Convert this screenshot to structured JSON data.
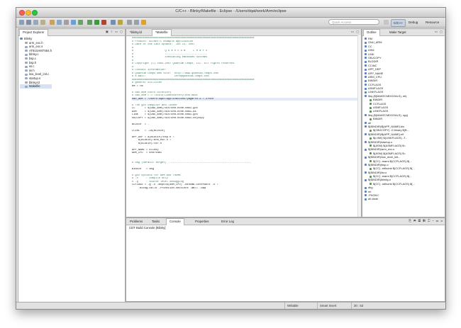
{
  "window": {
    "title": "C/C++ - Blinky/Makefile - Eclipse - /Users/dqat/work/Arm/eclipse"
  },
  "toolbar": {
    "quick_access_placeholder": "Quick Access",
    "perspectives": [
      "C/C++",
      "Debug",
      "Resource"
    ]
  },
  "project_explorer": {
    "tab_label": "Project Explorer",
    "items": [
      {
        "label": "Blinky",
        "depth": 0,
        "icon": "project-icon"
      },
      {
        "label": "arm_exc.h",
        "depth": 1,
        "icon": "file-icon"
      },
      {
        "label": "arm_exc.s",
        "depth": 1,
        "icon": "file-icon"
      },
      {
        "label": "AT91SAM7S64.h",
        "depth": 1,
        "icon": "file-icon"
      },
      {
        "label": "blinky.c",
        "depth": 1,
        "icon": "file-icon"
      },
      {
        "label": "bsp.c",
        "depth": 1,
        "icon": "file-icon"
      },
      {
        "label": "bsp.h",
        "depth": 1,
        "icon": "file-icon"
      },
      {
        "label": "isr.c",
        "depth": 1,
        "icon": "file-icon"
      },
      {
        "label": "isr.h",
        "depth": 1,
        "icon": "file-icon"
      },
      {
        "label": "low_level_init.c",
        "depth": 1,
        "icon": "file-icon"
      },
      {
        "label": "startup.s",
        "depth": 1,
        "icon": "file-icon"
      },
      {
        "label": "blinky.ld",
        "depth": 1,
        "icon": "file-icon"
      },
      {
        "label": "Makefile",
        "depth": 1,
        "icon": "file-icon"
      }
    ]
  },
  "editor": {
    "tabs": [
      "*blinky.ld",
      "*Makefile"
    ],
    "lines": [
      {
        "t": "##############################################################################",
        "c": "comment"
      },
      {
        "t": "# Product: BLINKY/C example application",
        "c": "comment"
      },
      {
        "t": "# Date of the Last Update:  Jun 14, 2007",
        "c": "comment"
      },
      {
        "t": "#",
        "c": "comment"
      },
      {
        "t": "#                    Q u a n t u m     L e a P s",
        "c": "comment"
      },
      {
        "t": "#                    ---------------------------",
        "c": "comment"
      },
      {
        "t": "#                    innovating embedded systems",
        "c": "comment"
      },
      {
        "t": "#",
        "c": "comment"
      },
      {
        "t": "# Copyright (C) 2002-2007 Quantum Leaps, LLC. All rights reserved.",
        "c": "comment"
      },
      {
        "t": "#",
        "c": "comment"
      },
      {
        "t": "# Contact information:",
        "c": "comment"
      },
      {
        "t": "# Quantum Leaps Web site:  http://www.quantum-leaps.com",
        "c": "comment"
      },
      {
        "t": "# e-mail:                  info@quantum-leaps.com",
        "c": "comment"
      },
      {
        "t": "##############################################################################",
        "c": "comment"
      },
      {
        "t": "# general utilities",
        "c": "comment"
      },
      {
        "t": "RM = rm",
        "c": "plain"
      },
      {
        "t": "",
        "c": "plain"
      },
      {
        "t": "# GNU-ARM tools directory",
        "c": "comment"
      },
      {
        "t": "# GNU_ARM = C:\\tools\\CodeSourcery\\arm-eabi",
        "c": "comment"
      },
      {
        "t": "GNU_ARM = /Users/dqat/Applications/yagarto-4.7.2/bin",
        "c": "plain",
        "hl": true
      },
      {
        "t": "",
        "c": "plain"
      },
      {
        "t": "# The gcc compiler and linker",
        "c": "comment"
      },
      {
        "t": "CC      = $(GNU_ARM)/bin/arm-none-eabi-gcc",
        "c": "plain"
      },
      {
        "t": "ASM     = $(GNU_ARM)/bin/arm-none-eabi-as",
        "c": "plain"
      },
      {
        "t": "LINK    = $(GNU_ARM)/bin/arm-none-eabi-gcc",
        "c": "plain"
      },
      {
        "t": "OBJCOPY = $(GNU_ARM)/bin/arm-none-eabi-objcopy",
        "c": "plain"
      },
      {
        "t": "",
        "c": "plain"
      },
      {
        "t": "BLDDIR  = .",
        "c": "plain"
      },
      {
        "t": "",
        "c": "plain"
      },
      {
        "t": "CCINC   = -I$(BLDDIR)",
        "c": "plain"
      },
      {
        "t": "",
        "c": "plain"
      },
      {
        "t": "APP_DEP = $(BLDDIR)/bsp.h \\",
        "c": "plain"
      },
      {
        "t": "    $(BLDDIR)/arm_exc.h \\",
        "c": "plain"
      },
      {
        "t": "    $(BLDDIR)/isr.h",
        "c": "plain"
      },
      {
        "t": "",
        "c": "plain"
      },
      {
        "t": "APP_NAME = blinky",
        "c": "plain"
      },
      {
        "t": "ARM_CPU  = arm7tdmi",
        "c": "plain"
      },
      {
        "t": "",
        "c": "plain"
      },
      {
        "t": "",
        "c": "plain"
      },
      {
        "t": "# dbg (default target) -----------------------------------------------------",
        "c": "comment"
      },
      {
        "t": "",
        "c": "plain"
      },
      {
        "t": "BINDIR   = dbg",
        "c": "plain"
      },
      {
        "t": "",
        "c": "plain"
      },
      {
        "t": "# gcc options for ARM and THUMB",
        "c": "comment"
      },
      {
        "t": "# -c     : compile only",
        "c": "comment"
      },
      {
        "t": "# -g     : source level debugging",
        "c": "comment"
      },
      {
        "t": "CCFLAGS = -g -c -mcpu=$(ARM_CPU) -mthumb-interwork -O \\",
        "c": "plain"
      },
      {
        "t": "    -mlong-calls -ffunction-sections -Wall -o$@",
        "c": "plain"
      }
    ]
  },
  "outline": {
    "tabs": [
      "Outline",
      "Make Target"
    ],
    "items": [
      {
        "label": "RM",
        "depth": 0
      },
      {
        "label": "GNU_ARM",
        "depth": 0
      },
      {
        "label": "CC",
        "depth": 0
      },
      {
        "label": "ASM",
        "depth": 0
      },
      {
        "label": "LINK",
        "depth": 0
      },
      {
        "label": "OBJCOPY",
        "depth": 0
      },
      {
        "label": "BLDDIR",
        "depth": 0
      },
      {
        "label": "CCINC",
        "depth": 0
      },
      {
        "label": "APP_DEP",
        "depth": 0
      },
      {
        "label": "APP_NAME",
        "depth": 0
      },
      {
        "label": "ARM_CPU",
        "depth": 0
      },
      {
        "label": "BINDIR",
        "depth": 0
      },
      {
        "label": "CCFLAGS",
        "depth": 0
      },
      {
        "label": "ASMFLAGS",
        "depth": 0
      },
      {
        "label": "LINKFLAGS",
        "depth": 0
      },
      {
        "label": "ifeq ($(MAKECMDGOALS), rel)",
        "depth": 0
      },
      {
        "label": "BINDIR",
        "depth": 1
      },
      {
        "label": "CCFLAGS",
        "depth": 1
      },
      {
        "label": "ASMFLAGS",
        "depth": 1
      },
      {
        "label": "LINKFLAGS",
        "depth": 1
      },
      {
        "label": "ifeq ($(MAKECMDGOALS), spy)",
        "depth": 0
      },
      {
        "label": "BINDIR",
        "depth": 1
      },
      {
        "label": "all",
        "depth": 0
      },
      {
        "label": "$(BINDIR)/$(APP_NAME).bin",
        "depth": 0
      },
      {
        "label": "$(OBJCOPY) -O binary $(B...",
        "depth": 1
      },
      {
        "label": "$(BINDIR)/$(APP_NAME).elf",
        "depth": 0
      },
      {
        "label": "$(LINK) $(LINKFLAGS) -T...",
        "depth": 1
      },
      {
        "label": "$(BINDIR)/startup.o",
        "depth": 0
      },
      {
        "label": "$(ASM) $(ASMFLAGS) $<",
        "depth": 1
      },
      {
        "label": "$(BINDIR)/arm_exc.o",
        "depth": 0
      },
      {
        "label": "$(ASM) $(ASMFLAGS) $<",
        "depth": 1
      },
      {
        "label": "$(BINDIR)/low_level_init...",
        "depth": 0
      },
      {
        "label": "$(CC) -marm $(CCFLAGS) $(...",
        "depth": 1
      },
      {
        "label": "$(BINDIR)/bsp.o",
        "depth": 0
      },
      {
        "label": "$(CC) -mthumb $(CCFLAGS) $(...",
        "depth": 1
      },
      {
        "label": "$(BINDIR)/isr.o",
        "depth": 0
      },
      {
        "label": "$(CC) -marm $(CCFLAGS) $(...",
        "depth": 1
      },
      {
        "label": "$(BINDIR)/blinky.o",
        "depth": 0
      },
      {
        "label": "$(CC) -mthumb $(CCFLAGS) $(...",
        "depth": 1
      },
      {
        "label": "dbg",
        "depth": 0
      },
      {
        "label": "rel",
        "depth": 0
      },
      {
        "label": ".PHONY",
        "depth": 0
      },
      {
        "label": "all clean",
        "depth": 0
      }
    ]
  },
  "bottom_panel": {
    "tabs": [
      "Problems",
      "Tasks",
      "Console",
      "Properties",
      "Error Log"
    ],
    "console_title": "CDT Build Console [Blinky]"
  },
  "status_bar": {
    "writable": "Writable",
    "insert_mode": "Smart Insert",
    "position": "20 : 53"
  }
}
